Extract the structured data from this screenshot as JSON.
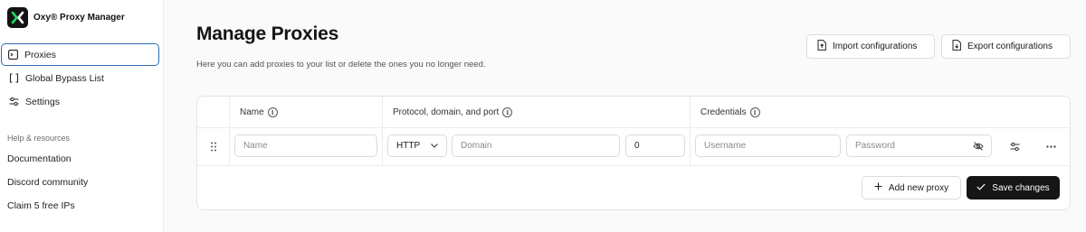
{
  "app": {
    "name": "Oxy® Proxy Manager"
  },
  "sidebar": {
    "nav": [
      {
        "label": "Proxies",
        "icon": "terminal-icon",
        "active": true
      },
      {
        "label": "Global Bypass List",
        "icon": "brackets-icon",
        "active": false
      },
      {
        "label": "Settings",
        "icon": "sliders-icon",
        "active": false
      }
    ],
    "help_title": "Help & resources",
    "help_links": [
      "Documentation",
      "Discord community",
      "Claim 5 free IPs"
    ]
  },
  "main": {
    "title": "Manage Proxies",
    "subtitle": "Here you can add proxies to your list or delete the ones you no longer need.",
    "import_label": "Import configurations",
    "export_label": "Export configurations"
  },
  "table": {
    "columns": [
      "Name",
      "Protocol, domain, and port",
      "Credentials"
    ],
    "row": {
      "name_placeholder": "Name",
      "name_value": "",
      "protocol": "HTTP",
      "domain_placeholder": "Domain",
      "domain_value": "",
      "port": "0",
      "username_placeholder": "Username",
      "username_value": "",
      "password_placeholder": "Password",
      "password_value": ""
    },
    "add_label": "Add new proxy",
    "save_label": "Save changes"
  },
  "colors": {
    "accent_border": "#2d6db5",
    "primary_button": "#161616",
    "logo_bg": "#141414",
    "logo_mark": "#1ed760"
  }
}
